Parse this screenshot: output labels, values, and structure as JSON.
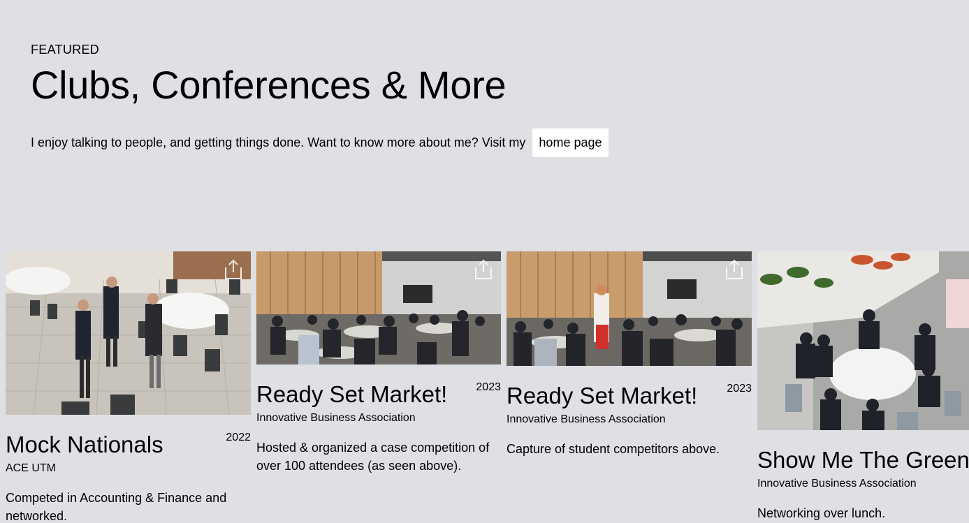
{
  "header": {
    "eyebrow": "FEATURED",
    "title": "Clubs, Conferences & More",
    "intro": "I enjoy talking to people, and getting things done. Want to know more about me? Visit my",
    "home_link": "home page"
  },
  "cards": [
    {
      "title": "Mock Nationals",
      "year": "2022",
      "org": "ACE UTM",
      "description": "Competed in Accounting & Finance and networked.",
      "photo_icon": "photo-mock-nationals",
      "share_icon": "share-icon"
    },
    {
      "title": "Ready Set Market!",
      "year": "2023",
      "org": "Innovative Business Association",
      "description": "Hosted & organized a case competition of over 100 attendees (as seen above).",
      "photo_icon": "photo-ready-set-market-hall",
      "share_icon": "share-icon"
    },
    {
      "title": "Ready Set Market!",
      "year": "2023",
      "org": "Innovative Business Association",
      "description": "Capture of student competitors above.",
      "photo_icon": "photo-ready-set-market-competitors",
      "share_icon": "share-icon"
    },
    {
      "title": "Show Me The Green",
      "year": "",
      "org": "Innovative Business Association",
      "description": "Networking over lunch.",
      "photo_icon": "photo-show-me-the-green",
      "share_icon": "share-icon"
    }
  ],
  "colors": {
    "background": "#dee0e4",
    "link_background": "#ffffff",
    "text": "#000000"
  }
}
